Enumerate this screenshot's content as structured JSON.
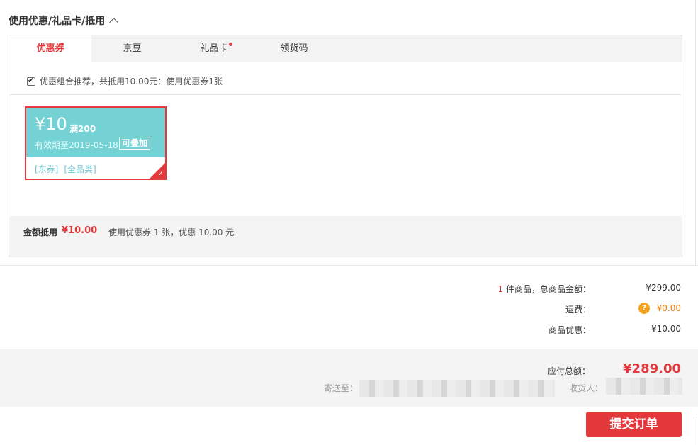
{
  "section": {
    "title": "使用优惠/礼品卡/抵用"
  },
  "tabs": [
    {
      "label": "优惠券",
      "active": true,
      "dot": true
    },
    {
      "label": "京豆",
      "active": false,
      "dot": false
    },
    {
      "label": "礼品卡",
      "active": false,
      "dot": true
    },
    {
      "label": "领货码",
      "active": false,
      "dot": false
    }
  ],
  "recommend": {
    "checked": true,
    "text": "优惠组合推荐，共抵用10.00元：使用优惠券1张"
  },
  "coupon": {
    "amount": "¥10",
    "condition": "满200",
    "expiry": "有效期至2019-05-18",
    "stackable": "可叠加",
    "tags": [
      "[东券]",
      "[全品类]"
    ],
    "selected": true
  },
  "panel_footer": {
    "label": "金额抵用",
    "amount": "¥10.00",
    "desc": "使用优惠券 1 张，优惠 10.00 元"
  },
  "summary": {
    "items_count": "1",
    "items_label": " 件商品，总商品金额：",
    "items_value": "¥299.00",
    "shipping_label": "运费：",
    "shipping_value": "¥0.00",
    "discount_label": "商品优惠：",
    "discount_value": "-¥10.00"
  },
  "total": {
    "label": "应付总额：",
    "value": "¥289.00",
    "ship_to_label": "寄送至：",
    "receiver_label": "收货人："
  },
  "submit": {
    "label": "提交订单"
  },
  "colors": {
    "accent_red": "#e4393c",
    "coupon_teal": "#74d2d4",
    "shipping_orange": "#f08000"
  }
}
